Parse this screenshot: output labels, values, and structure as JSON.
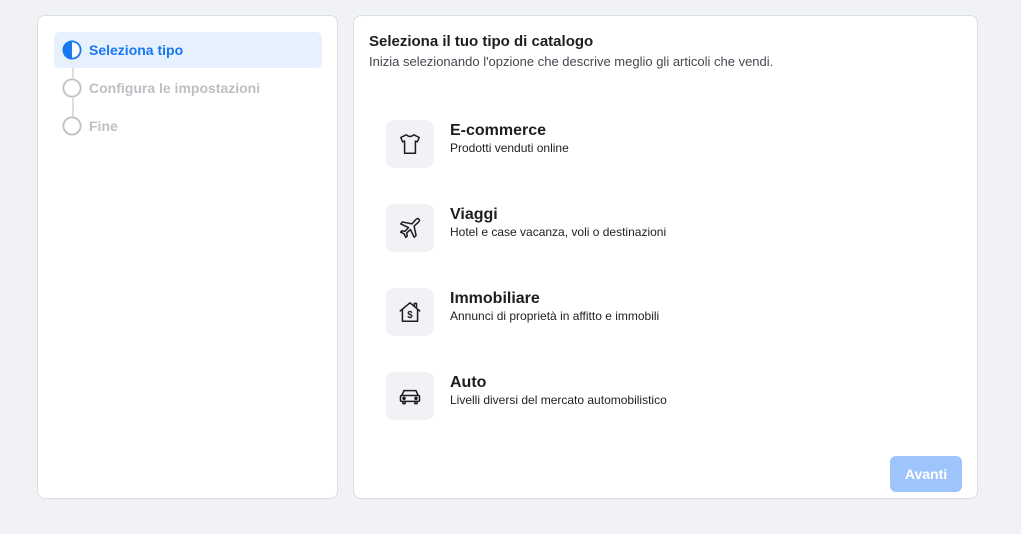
{
  "stepper": {
    "steps": [
      {
        "label": "Seleziona tipo",
        "state": "current"
      },
      {
        "label": "Configura le impostazioni",
        "state": "upcoming"
      },
      {
        "label": "Fine",
        "state": "upcoming"
      }
    ]
  },
  "main": {
    "title": "Seleziona il tuo tipo di catalogo",
    "subtitle": "Inizia selezionando l'opzione che descrive meglio gli articoli che vendi.",
    "options": [
      {
        "icon": "tshirt-icon",
        "title": "E-commerce",
        "description": "Prodotti venduti online"
      },
      {
        "icon": "airplane-icon",
        "title": "Viaggi",
        "description": "Hotel e case vacanza, voli o destinazioni"
      },
      {
        "icon": "house-dollar-icon",
        "title": "Immobiliare",
        "description": "Annunci di proprietà in affitto e immobili"
      },
      {
        "icon": "car-icon",
        "title": "Auto",
        "description": "Livelli diversi del mercato automobilistico"
      }
    ],
    "next_button_label": "Avanti",
    "next_button_state": "disabled"
  },
  "colors": {
    "accent": "#1877f2",
    "accent_background": "#e7f0fd",
    "disabled_button": "#9ec5fb",
    "page_background": "#f0f2f5",
    "muted_text": "#bcc0c4"
  }
}
